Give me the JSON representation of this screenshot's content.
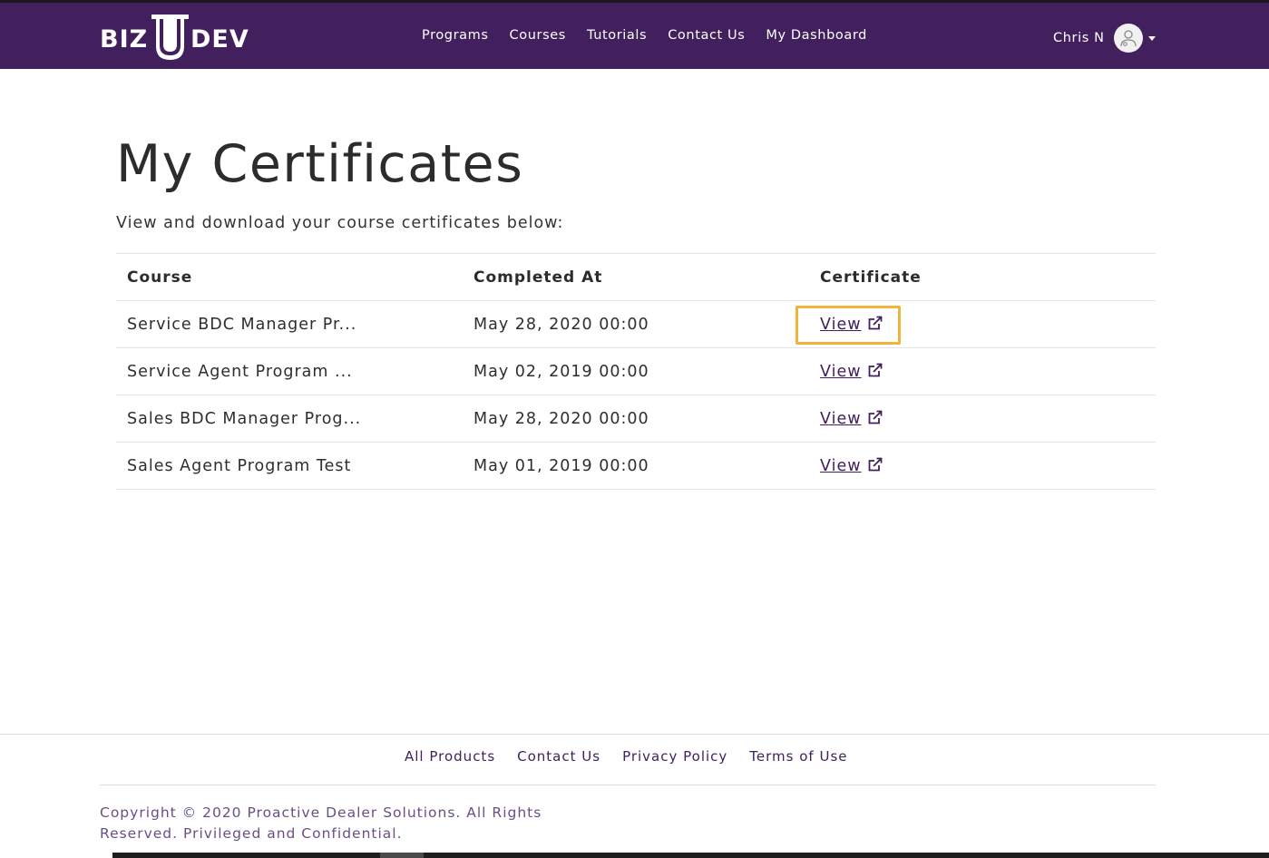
{
  "brand": {
    "logo_left": "BIZ",
    "logo_mid": "U",
    "logo_right": "DEV",
    "header_bg": "#42205e",
    "accent": "#f0b43c"
  },
  "nav": {
    "items": [
      "Programs",
      "Courses",
      "Tutorials",
      "Contact Us",
      "My Dashboard"
    ]
  },
  "user": {
    "name": "Chris N",
    "avatar_icon": "user-avatar-icon",
    "menu_icon": "caret-down-icon"
  },
  "main": {
    "title": "My Certificates",
    "subtitle": "View and download your course certificates below:"
  },
  "table": {
    "headers": [
      "Course",
      "Completed At",
      "Certificate"
    ],
    "rows": [
      {
        "course": "Service BDC Manager Pr...",
        "completed": "May 28, 2020 00:00",
        "link": "View",
        "focused": true
      },
      {
        "course": "Service Agent Program ...",
        "completed": "May 02, 2019 00:00",
        "link": "View",
        "focused": false
      },
      {
        "course": "Sales BDC Manager Prog...",
        "completed": "May 28, 2020 00:00",
        "link": "View",
        "focused": false
      },
      {
        "course": "Sales Agent Program Test",
        "completed": "May 01, 2019 00:00",
        "link": "View",
        "focused": false
      }
    ],
    "link_icon": "external-link-icon"
  },
  "footer": {
    "links": [
      "All Products",
      "Contact Us",
      "Privacy Policy",
      "Terms of Use"
    ],
    "copyright": "Copyright © 2020 Proactive Dealer Solutions. All Rights Reserved. Privileged and Confidential."
  }
}
